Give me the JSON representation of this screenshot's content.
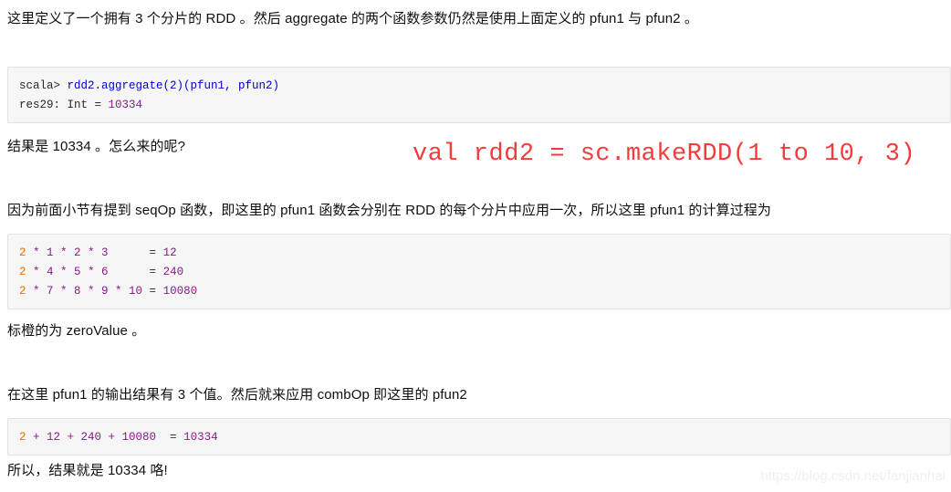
{
  "document": {
    "paragraphs": {
      "intro": "这里定义了一个拥有 3 个分片的 RDD 。然后 aggregate 的两个函数参数仍然是使用上面定义的 pfun1 与 pfun2 。",
      "result": "结果是 10334 。怎么来的呢?",
      "seqop_explanation": "因为前面小节有提到 seqOp 函数，即这里的 pfun1 函数会分别在 RDD 的每个分片中应用一次，所以这里 pfun1 的计算过程为",
      "orange_note": "标橙的为 zeroValue 。",
      "combop_explanation": "在这里 pfun1 的输出结果有 3 个值。然后就来应用 combOp 即这里的 pfun2",
      "final": "所以，结果就是 10334 咯!"
    },
    "annotation": {
      "text": "val rdd2 = sc.makeRDD(1 to 10, 3)",
      "color": "#f43b3b"
    },
    "watermark": {
      "text": "https://blog.csdn.net/fanjianhai"
    },
    "code_block_1": {
      "line1": {
        "prompt": "scala> ",
        "expression": "rdd2.aggregate(2)(pfun1, pfun2)"
      },
      "line2": {
        "label": "res29: Int = ",
        "value": "10334"
      }
    },
    "code_block_2": {
      "rows": [
        {
          "zero": "2",
          "body": " * 1 * 2 * 3      ",
          "eq": "= ",
          "value": "12"
        },
        {
          "zero": "2",
          "body": " * 4 * 5 * 6      ",
          "eq": "= ",
          "value": "240"
        },
        {
          "zero": "2",
          "body": " * 7 * 8 * 9 * 10 ",
          "eq": "= ",
          "value": "10080"
        }
      ]
    },
    "code_block_3": {
      "zero": "2",
      "body": " + 12 + 240 + 10080  ",
      "eq": "= ",
      "value": "10334"
    },
    "colors": {
      "code_background": "#f6f6f6",
      "code_border": "#e3e3e3",
      "zero_value": "#f07000",
      "number": "#8b1a8b",
      "expression": "#0000cc",
      "annotation_red": "#f43b3b"
    }
  }
}
